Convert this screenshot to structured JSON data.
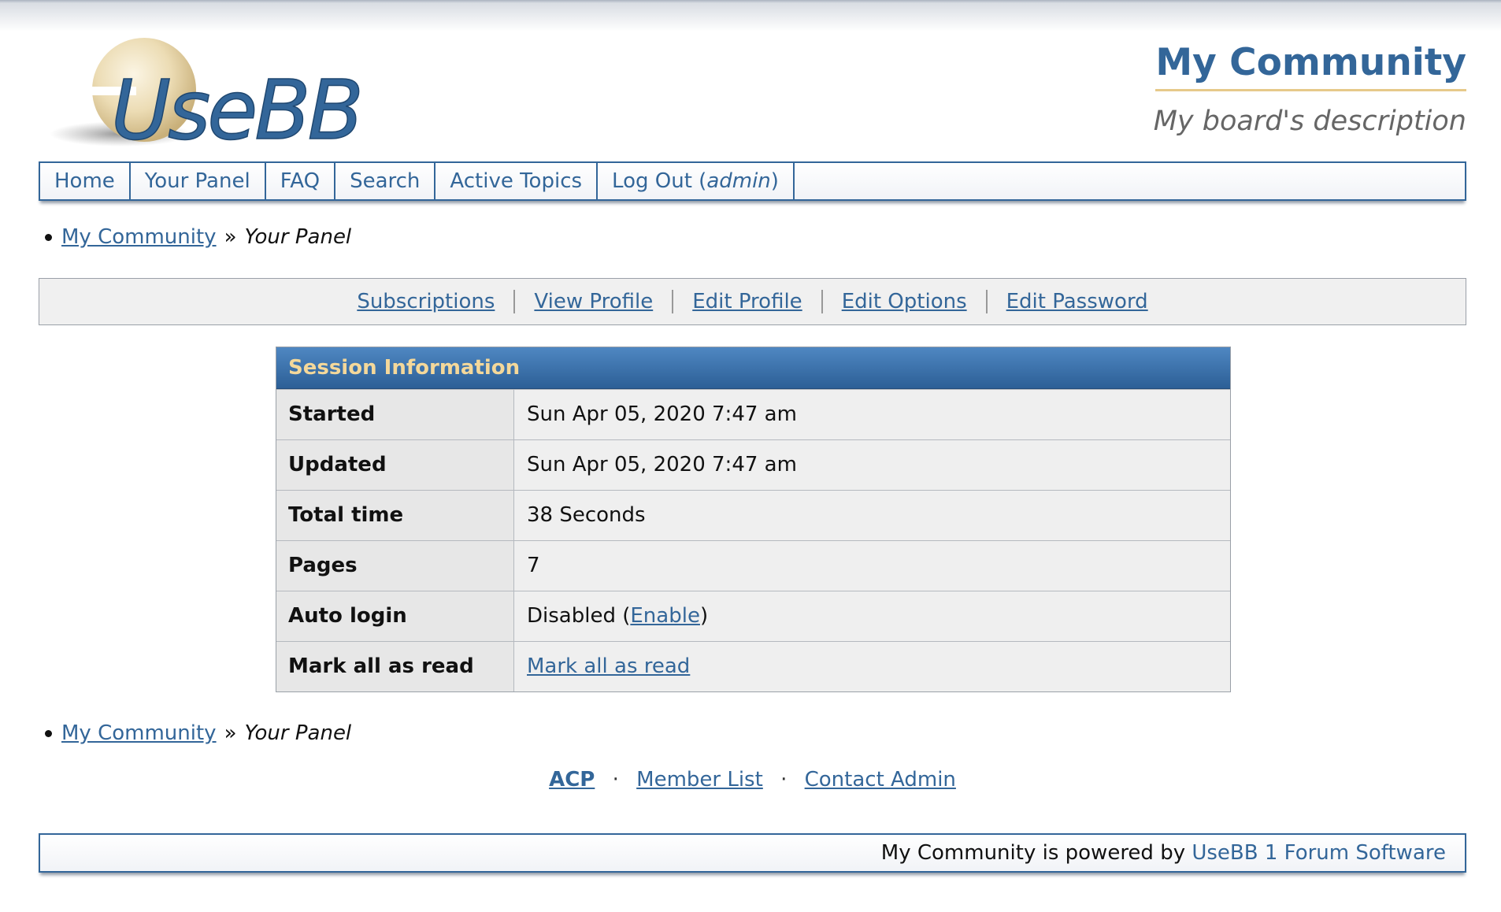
{
  "header": {
    "logo_text": "UseBB",
    "board_title": "My Community",
    "board_description": "My board's description"
  },
  "menu": {
    "items": [
      {
        "label": "Home"
      },
      {
        "label": "Your Panel"
      },
      {
        "label": "FAQ"
      },
      {
        "label": "Search"
      },
      {
        "label": "Active Topics"
      }
    ],
    "logout_label": "Log Out",
    "logout_user": "admin"
  },
  "breadcrumb": {
    "home": "My Community",
    "separator": "»",
    "current": "Your Panel"
  },
  "panel_menu": {
    "items": [
      {
        "label": "Subscriptions"
      },
      {
        "label": "View Profile"
      },
      {
        "label": "Edit Profile"
      },
      {
        "label": "Edit Options"
      },
      {
        "label": "Edit Password"
      }
    ]
  },
  "session": {
    "title": "Session Information",
    "rows": [
      {
        "label": "Started",
        "value": "Sun Apr 05, 2020 7:47 am"
      },
      {
        "label": "Updated",
        "value": "Sun Apr 05, 2020 7:47 am"
      },
      {
        "label": "Total time",
        "value": "38 Seconds"
      },
      {
        "label": "Pages",
        "value": "7"
      },
      {
        "label": "Auto login",
        "value": "Disabled",
        "action": "Enable"
      },
      {
        "label": "Mark all as read",
        "action": "Mark all as read"
      }
    ]
  },
  "footer_links": {
    "acp": "ACP",
    "member_list": "Member List",
    "contact_admin": "Contact Admin",
    "separator": "·"
  },
  "powered": {
    "text": "My Community is powered by",
    "link": "UseBB 1 Forum Software"
  },
  "colors": {
    "accent": "#336699",
    "header_text": "#f4d89a",
    "title_underline": "#e6c98a"
  }
}
